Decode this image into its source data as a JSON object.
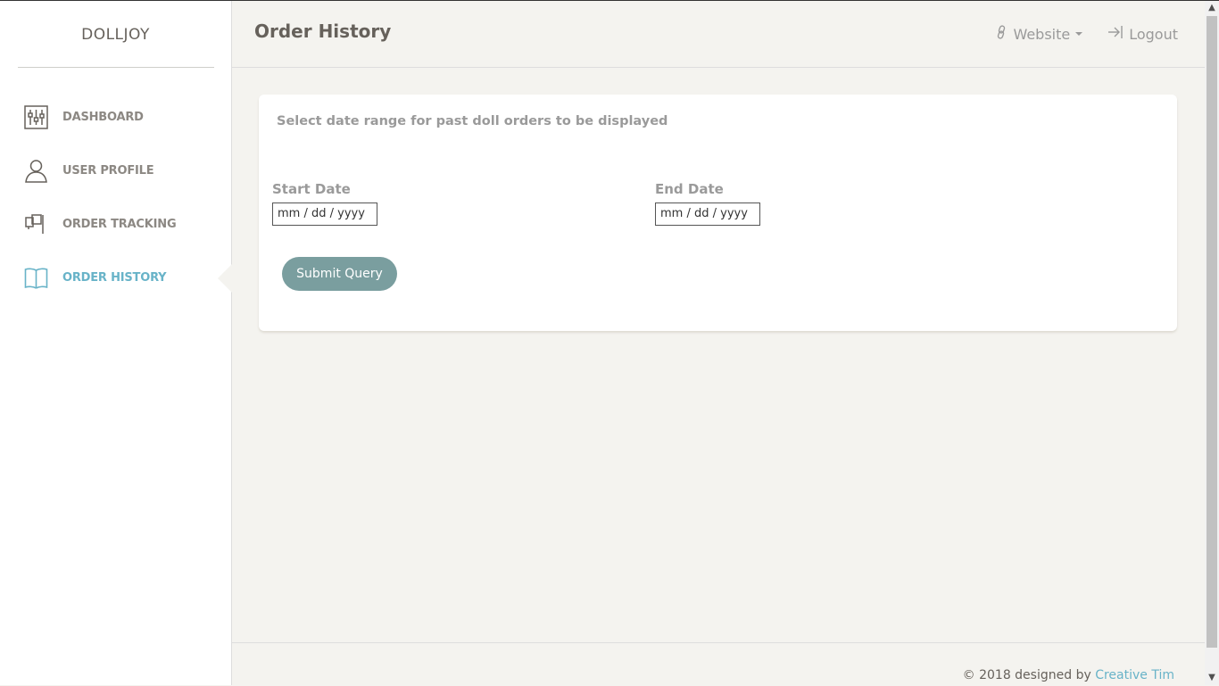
{
  "sidebar": {
    "brand": "DOLLJOY",
    "items": [
      {
        "label": "DASHBOARD",
        "icon": "sliders-icon"
      },
      {
        "label": "USER PROFILE",
        "icon": "user-icon"
      },
      {
        "label": "ORDER TRACKING",
        "icon": "tracking-icon"
      },
      {
        "label": "ORDER HISTORY",
        "icon": "book-icon",
        "active": true
      }
    ]
  },
  "header": {
    "title": "Order History",
    "website_label": "Website",
    "logout_label": "Logout"
  },
  "card": {
    "title": "Select date range for past doll orders to be displayed",
    "start_label": "Start Date",
    "start_value": "mm / dd / yyyy",
    "end_label": "End Date",
    "end_value": "mm / dd / yyyy",
    "submit_label": "Submit Query"
  },
  "footer": {
    "prefix": "© 2018 designed by",
    "link": "Creative Tim"
  },
  "colors": {
    "accent": "#68b3c8",
    "button": "#7a9e9f",
    "background": "#f4f3ef"
  }
}
